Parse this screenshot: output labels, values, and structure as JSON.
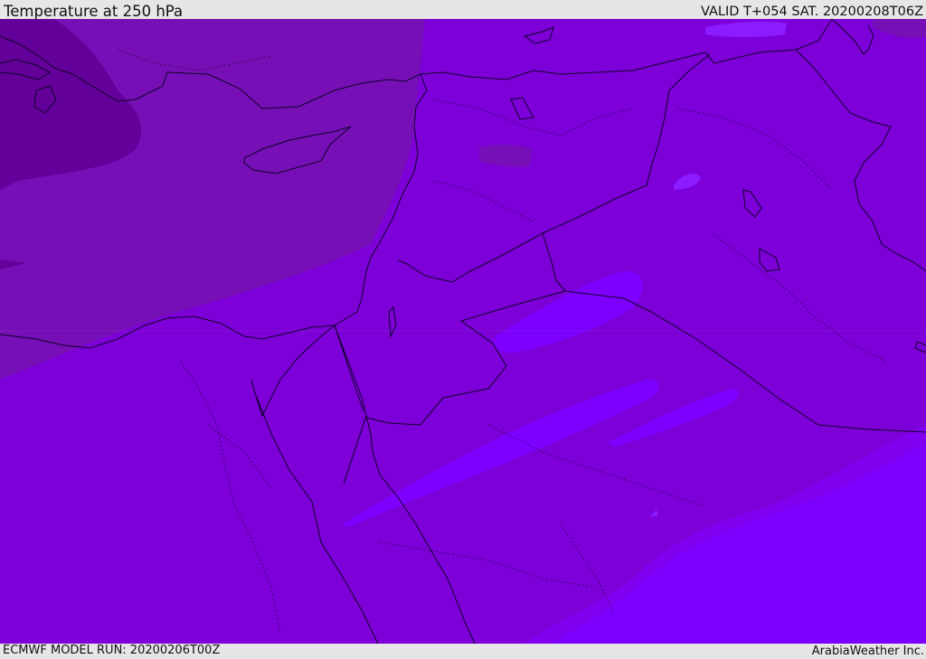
{
  "header": {
    "title": "Temperature at 250 hPa",
    "valid": "VALID T+054 SAT. 20200208T06Z"
  },
  "footer": {
    "model_run": "ECMWF MODEL RUN: 20200206T00Z",
    "credit": "ArabiaWeather Inc."
  },
  "map": {
    "colors": {
      "darkest": "#64009a",
      "dark": "#7610b6",
      "mid": "#7d00d9",
      "light": "#8200f0",
      "lightest": "#7d00ff",
      "brightest": "#8a1cff",
      "boundary": "#0f0028"
    }
  }
}
